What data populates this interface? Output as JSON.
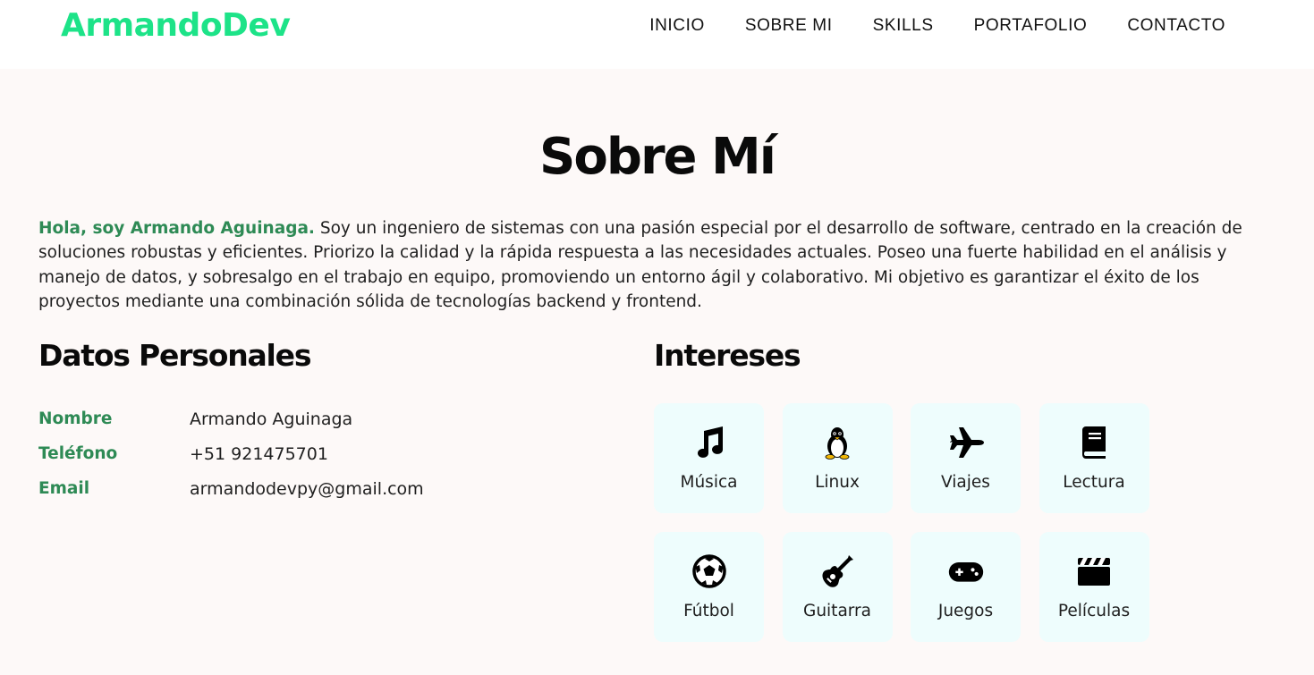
{
  "brand": {
    "logo": "ArmandoDev",
    "accent": "#1de388",
    "highlight": "#2e8a55"
  },
  "nav": {
    "items": [
      "INICIO",
      "SOBRE MI",
      "SKILLS",
      "PORTAFOLIO",
      "CONTACTO"
    ]
  },
  "about": {
    "title": "Sobre Mí",
    "intro_highlight": "Hola, soy Armando Aguinaga.",
    "intro_text": " Soy un ingeniero de sistemas con una pasión especial por el desarrollo de software, centrado en la creación de soluciones robustas y eficientes. Priorizo la calidad y la rápida respuesta a las necesidades actuales. Poseo una fuerte habilidad en el análisis y manejo de datos, y sobresalgo en el trabajo en equipo, promoviendo un entorno ágil y colaborativo. Mi objetivo es garantizar el éxito de los proyectos mediante una combinación sólida de tecnologías backend y frontend."
  },
  "personal": {
    "title": "Datos Personales",
    "rows": [
      {
        "label": "Nombre",
        "value": "Armando Aguinaga"
      },
      {
        "label": "Teléfono",
        "value": "+51 921475701"
      },
      {
        "label": "Email",
        "value": "armandodevpy@gmail.com"
      }
    ]
  },
  "interests": {
    "title": "Intereses",
    "items": [
      {
        "label": "Música",
        "icon": "music-icon"
      },
      {
        "label": "Linux",
        "icon": "linux-icon"
      },
      {
        "label": "Viajes",
        "icon": "plane-icon"
      },
      {
        "label": "Lectura",
        "icon": "book-icon"
      },
      {
        "label": "Fútbol",
        "icon": "soccer-ball-icon"
      },
      {
        "label": "Guitarra",
        "icon": "guitar-icon"
      },
      {
        "label": "Juegos",
        "icon": "gamepad-icon"
      },
      {
        "label": "Películas",
        "icon": "clapperboard-icon"
      }
    ]
  }
}
